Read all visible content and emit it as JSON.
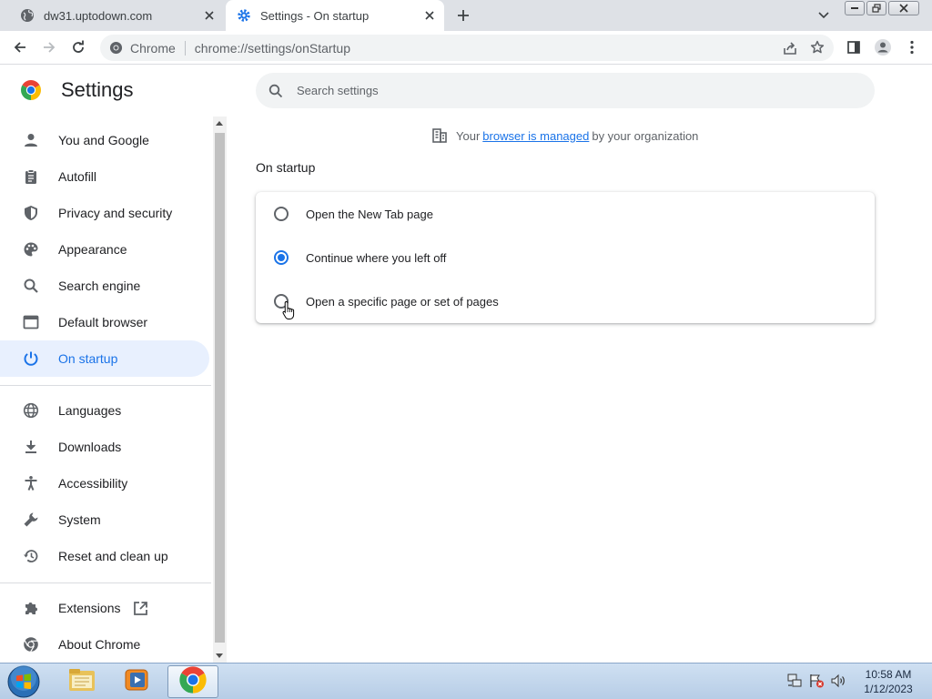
{
  "tabs": [
    {
      "title": "dw31.uptodown.com",
      "active": false,
      "icon": "globe-icon"
    },
    {
      "title": "Settings - On startup",
      "active": true,
      "icon": "gear-icon"
    }
  ],
  "toolbar": {
    "site_chip": "Chrome",
    "url": "chrome://settings/onStartup"
  },
  "settings": {
    "title": "Settings",
    "search_placeholder": "Search settings"
  },
  "sidebar": {
    "items": [
      {
        "label": "You and Google",
        "icon": "person-icon"
      },
      {
        "label": "Autofill",
        "icon": "clipboard-icon"
      },
      {
        "label": "Privacy and security",
        "icon": "shield-icon"
      },
      {
        "label": "Appearance",
        "icon": "palette-icon"
      },
      {
        "label": "Search engine",
        "icon": "search-icon"
      },
      {
        "label": "Default browser",
        "icon": "browser-icon"
      },
      {
        "label": "On startup",
        "icon": "power-icon",
        "selected": true
      },
      {
        "label": "Languages",
        "icon": "globe-icon"
      },
      {
        "label": "Downloads",
        "icon": "download-icon"
      },
      {
        "label": "Accessibility",
        "icon": "accessibility-icon"
      },
      {
        "label": "System",
        "icon": "wrench-icon"
      },
      {
        "label": "Reset and clean up",
        "icon": "restore-icon"
      },
      {
        "label": "Extensions",
        "icon": "puzzle-icon"
      },
      {
        "label": "About Chrome",
        "icon": "chrome-icon"
      }
    ]
  },
  "managed": {
    "prefix": "Your",
    "link": "browser is managed",
    "suffix": "by your organization"
  },
  "startup": {
    "section_title": "On startup",
    "options": [
      {
        "label": "Open the New Tab page",
        "checked": false
      },
      {
        "label": "Continue where you left off",
        "checked": true
      },
      {
        "label": "Open a specific page or set of pages",
        "checked": false
      }
    ]
  },
  "taskbar": {
    "time": "10:58 AM",
    "date": "1/12/2023"
  },
  "colors": {
    "accent": "#1a73e8",
    "selected_bg": "#e8f0fe",
    "tabstrip_bg": "#dee1e6"
  }
}
